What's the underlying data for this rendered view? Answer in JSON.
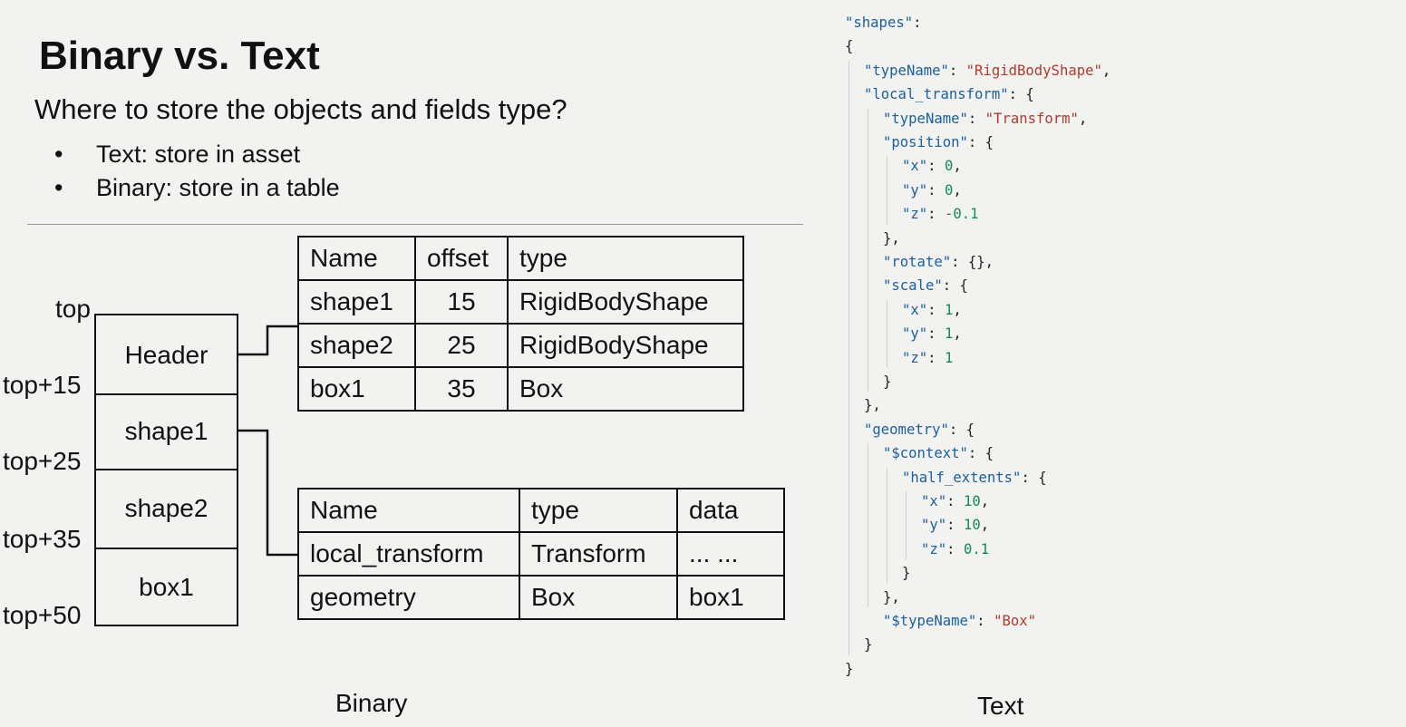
{
  "title": "Binary vs. Text",
  "subtitle": "Where to store the objects and fields type?",
  "bullets": [
    "Text: store in asset",
    "Binary: store in a table"
  ],
  "bullet_symbol": "•",
  "memory_blocks": [
    "Header",
    "shape1",
    "shape2",
    "box1"
  ],
  "offset_labels": [
    "top",
    "top+15",
    "top+25",
    "top+35",
    "top+50"
  ],
  "object_table": {
    "headers": [
      "Name",
      "offset",
      "type"
    ],
    "rows": [
      [
        "shape1",
        "15",
        "RigidBodyShape"
      ],
      [
        "shape2",
        "25",
        "RigidBodyShape"
      ],
      [
        "box1",
        "35",
        "Box"
      ]
    ]
  },
  "field_table": {
    "headers": [
      "Name",
      "type",
      "data"
    ],
    "rows": [
      [
        "local_transform",
        "Transform",
        "... ..."
      ],
      [
        "geometry",
        "Box",
        "box1"
      ]
    ]
  },
  "captions": {
    "binary": "Binary",
    "text": "Text"
  },
  "colors": {
    "key": "#1b5f9e",
    "string": "#b03a2e",
    "number": "#138a5a",
    "background": "#f2f2f0"
  },
  "code_lines": [
    [
      [
        "k",
        "\"shapes\""
      ],
      [
        "p",
        ":"
      ]
    ],
    [
      [
        "p",
        "{"
      ]
    ],
    [
      [
        "k",
        "\"typeName\""
      ],
      [
        "p",
        ": "
      ],
      [
        "s",
        "\"RigidBodyShape\""
      ],
      [
        "p",
        ","
      ]
    ],
    [
      [
        "k",
        "\"local_transform\""
      ],
      [
        "p",
        ": {"
      ]
    ],
    [
      [
        "k",
        "\"typeName\""
      ],
      [
        "p",
        ": "
      ],
      [
        "s",
        "\"Transform\""
      ],
      [
        "p",
        ","
      ]
    ],
    [
      [
        "k",
        "\"position\""
      ],
      [
        "p",
        ": {"
      ]
    ],
    [
      [
        "k",
        "\"x\""
      ],
      [
        "p",
        ": "
      ],
      [
        "n",
        "0"
      ],
      [
        "p",
        ","
      ]
    ],
    [
      [
        "k",
        "\"y\""
      ],
      [
        "p",
        ": "
      ],
      [
        "n",
        "0"
      ],
      [
        "p",
        ","
      ]
    ],
    [
      [
        "k",
        "\"z\""
      ],
      [
        "p",
        ": "
      ],
      [
        "n",
        "-0.1"
      ]
    ],
    [
      [
        "p",
        "},"
      ]
    ],
    [
      [
        "k",
        "\"rotate\""
      ],
      [
        "p",
        ": {},"
      ]
    ],
    [
      [
        "k",
        "\"scale\""
      ],
      [
        "p",
        ": {"
      ]
    ],
    [
      [
        "k",
        "\"x\""
      ],
      [
        "p",
        ": "
      ],
      [
        "n",
        "1"
      ],
      [
        "p",
        ","
      ]
    ],
    [
      [
        "k",
        "\"y\""
      ],
      [
        "p",
        ": "
      ],
      [
        "n",
        "1"
      ],
      [
        "p",
        ","
      ]
    ],
    [
      [
        "k",
        "\"z\""
      ],
      [
        "p",
        ": "
      ],
      [
        "n",
        "1"
      ]
    ],
    [
      [
        "p",
        "}"
      ]
    ],
    [
      [
        "p",
        "},"
      ]
    ],
    [
      [
        "k",
        "\"geometry\""
      ],
      [
        "p",
        ": {"
      ]
    ],
    [
      [
        "k",
        "\"$context\""
      ],
      [
        "p",
        ": {"
      ]
    ],
    [
      [
        "k",
        "\"half_extents\""
      ],
      [
        "p",
        ": {"
      ]
    ],
    [
      [
        "k",
        "\"x\""
      ],
      [
        "p",
        ": "
      ],
      [
        "n",
        "10"
      ],
      [
        "p",
        ","
      ]
    ],
    [
      [
        "k",
        "\"y\""
      ],
      [
        "p",
        ": "
      ],
      [
        "n",
        "10"
      ],
      [
        "p",
        ","
      ]
    ],
    [
      [
        "k",
        "\"z\""
      ],
      [
        "p",
        ": "
      ],
      [
        "n",
        "0.1"
      ]
    ],
    [
      [
        "p",
        "}"
      ]
    ],
    [
      [
        "p",
        "},"
      ]
    ],
    [
      [
        "k",
        "\"$typeName\""
      ],
      [
        "p",
        ": "
      ],
      [
        "s",
        "\"Box\""
      ]
    ],
    [
      [
        "p",
        "}"
      ]
    ],
    [
      [
        "p",
        "}"
      ]
    ]
  ]
}
